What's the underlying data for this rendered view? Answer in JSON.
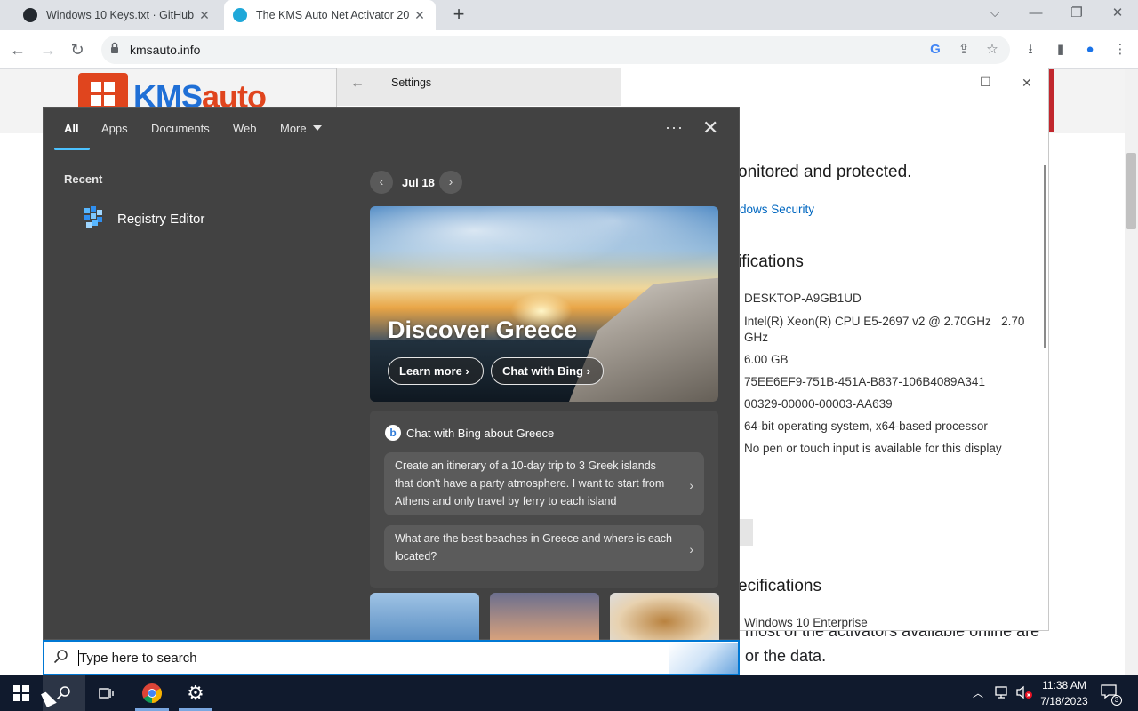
{
  "browser": {
    "tabs": [
      {
        "title": "Windows 10 Keys.txt · GitHub",
        "close": "✕"
      },
      {
        "title": "The KMS Auto Net Activator 20",
        "close": "✕"
      }
    ],
    "new_tab": "+",
    "url": "kmsauto.info",
    "window_controls": {
      "dropdown": "⌵",
      "minimize": "—",
      "restore": "❐",
      "close": "✕"
    }
  },
  "website": {
    "logo_text_a": "KMS",
    "logo_text_b": "auto",
    "bottom_line1": "most of the activators available online are",
    "bottom_line2": "or the data."
  },
  "settings": {
    "title": "Settings",
    "back": "←",
    "controls": {
      "minimize": "—",
      "maximize": "☐",
      "close": "✕"
    },
    "protected_text": "onitored and protected.",
    "security_link": "dows Security",
    "device_specs_heading": "ifications",
    "device_values": [
      "DESKTOP-A9GB1UD",
      "Intel(R) Xeon(R) CPU E5-2697 v2 @ 2.70GHz   2.70",
      "GHz",
      "6.00 GB",
      "75EE6EF9-751B-451A-B837-106B4089A341",
      "00329-00000-00003-AA639",
      "64-bit operating system, x64-based processor",
      "No pen or touch input is available for this display"
    ],
    "windows_specs_heading": "ecifications",
    "edition": "Windows 10 Enterprise"
  },
  "search_flyout": {
    "tabs": [
      "All",
      "Apps",
      "Documents",
      "Web",
      "More"
    ],
    "more_menu": "···",
    "close": "✕",
    "recent_label": "Recent",
    "recent_items": [
      {
        "label": "Registry Editor",
        "icon": "registry-editor-icon"
      }
    ],
    "date_label": "Jul 18",
    "prev": "‹",
    "next": "›",
    "hero": {
      "title": "Discover Greece",
      "learn_more": "Learn more",
      "chat_with_bing": "Chat with Bing"
    },
    "chat": {
      "icon_letter": "b",
      "title": "Chat with Bing about Greece",
      "prompts": [
        "Create an itinerary of a 10-day trip to 3 Greek islands that don't have a party atmosphere. I want to start from Athens and only travel by ferry to each island",
        "What are the best beaches in Greece and where is each located?"
      ]
    }
  },
  "searchbox": {
    "placeholder": "Type here to search"
  },
  "taskbar": {
    "time": "11:38 AM",
    "date": "7/18/2023",
    "notification_count": "3"
  },
  "colors": {
    "accent": "#0078d4",
    "taskbar": "#101a2d",
    "flyout": "#424242"
  }
}
